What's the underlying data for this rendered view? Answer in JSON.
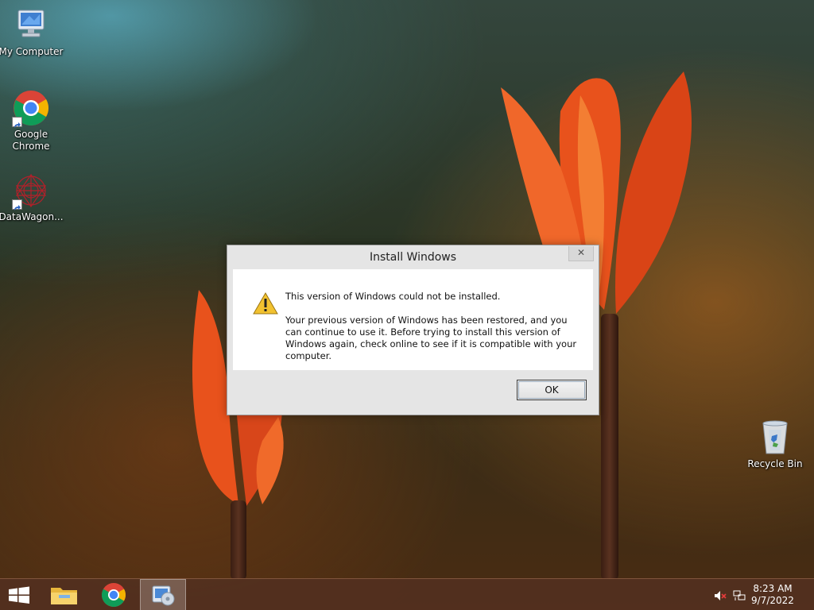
{
  "desktop": {
    "icons": [
      {
        "label": "My Computer",
        "icon": "computer-icon"
      },
      {
        "label": "Google Chrome",
        "icon": "chrome-icon"
      },
      {
        "label": "DataWagon...",
        "icon": "datawagon-icon"
      },
      {
        "label": "Recycle Bin",
        "icon": "recycle-bin-icon"
      }
    ]
  },
  "dialog": {
    "title": "Install Windows",
    "close_label": "✕",
    "message": "This version of Windows could not be installed.",
    "detail": "Your previous version of Windows has been restored, and you can continue to use it.  Before trying to install this version of Windows again, check online to see if it is compatible with your computer.",
    "ok_label": "OK",
    "icon": "warning-icon"
  },
  "taskbar": {
    "items": [
      {
        "icon": "start-icon",
        "active": false
      },
      {
        "icon": "file-explorer-icon",
        "active": false
      },
      {
        "icon": "chrome-icon",
        "active": false
      },
      {
        "icon": "windows-setup-icon",
        "active": true
      }
    ],
    "tray": {
      "volume_icon": "volume-muted-icon",
      "network_icon": "network-icon",
      "time": "8:23 AM",
      "date": "9/7/2022"
    }
  },
  "colors": {
    "taskbar": "#52301f",
    "dialog_background": "#e5e5e5",
    "warning": "#f2c230"
  }
}
